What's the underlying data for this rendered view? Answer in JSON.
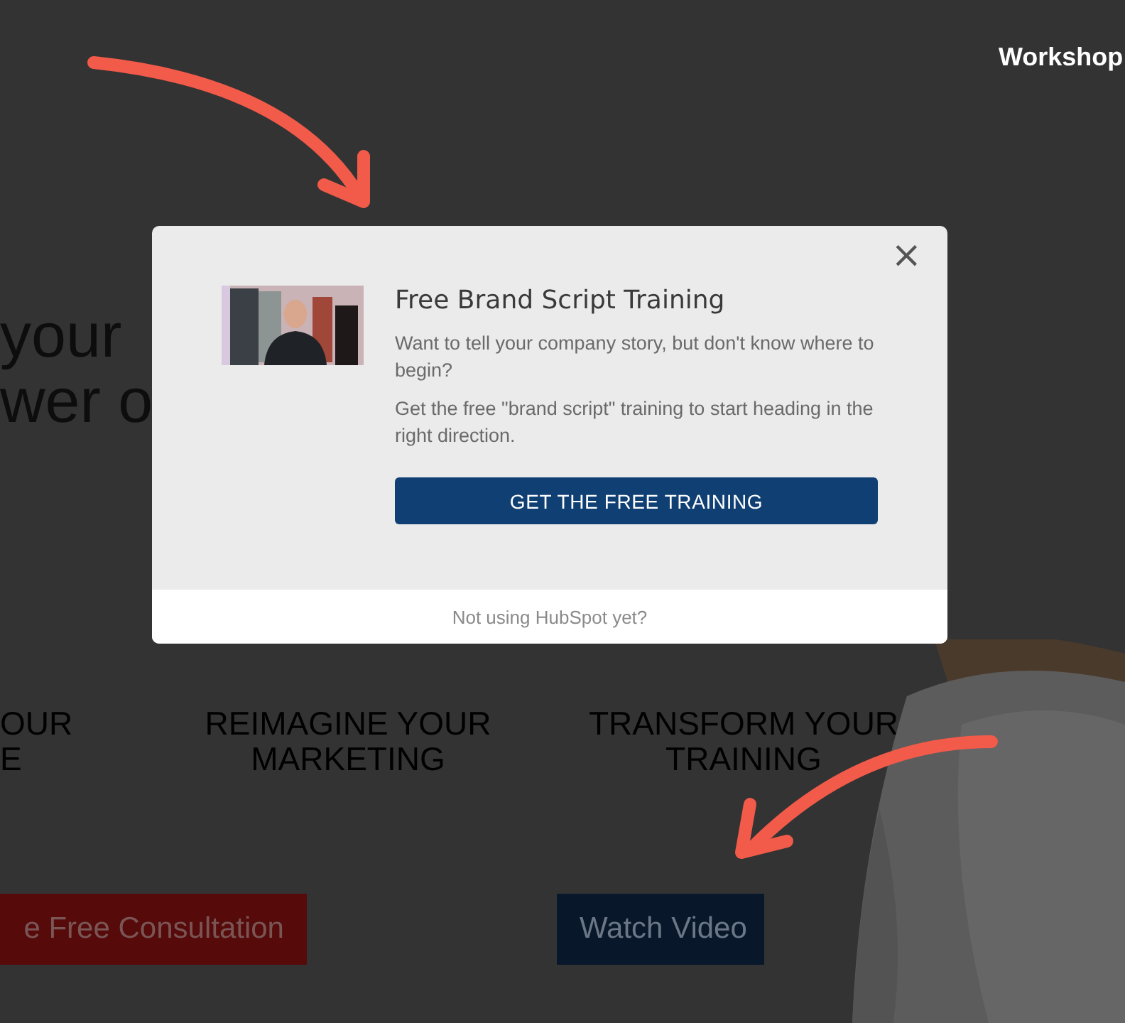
{
  "page": {
    "nav_link": "Workshop",
    "hero_lines": [
      "your",
      "wer o"
    ],
    "features": [
      {
        "lines": [
          "OUR",
          "E"
        ]
      },
      {
        "lines": [
          "REIMAGINE YOUR",
          "MARKETING"
        ]
      },
      {
        "lines": [
          "TRANSFORM YOUR",
          "TRAINING"
        ]
      }
    ],
    "buttons": [
      {
        "label": "e Free Consultation",
        "kind": "primary"
      },
      {
        "label": "Watch Video",
        "kind": "secondary"
      }
    ]
  },
  "modal": {
    "close": "×",
    "title": "Free Brand Script Training",
    "paragraphs": [
      "Want to tell your company story, but don't know where to begin?",
      "Get the free \"brand script\" training to start heading in the right direction."
    ],
    "cta": "GET THE FREE TRAINING",
    "footer_link": "Not using HubSpot yet?"
  }
}
